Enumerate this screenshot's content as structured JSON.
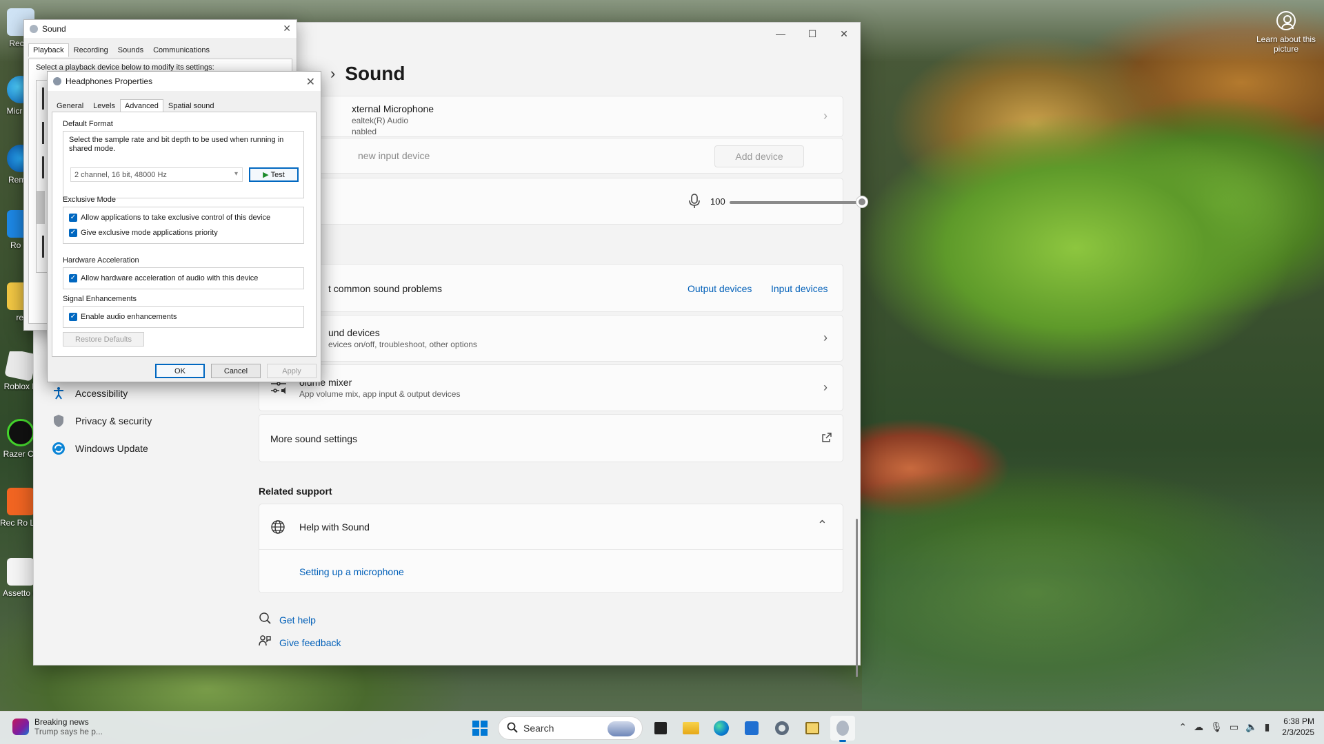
{
  "desktop": {
    "learn_picture": "Learn about this picture",
    "icons": [
      "Recyc",
      "Micr Ed",
      "Rem A",
      "Ro St",
      "rel",
      "Roblox P",
      "Razer Co",
      "Rec Ro Launc",
      "Assetto C"
    ]
  },
  "settings": {
    "breadcrumb_title": "Sound",
    "window_controls": [
      "—",
      "☐",
      "✕"
    ],
    "input_device": {
      "name": "xternal Microphone",
      "vendor": "ealtek(R) Audio",
      "status": "nabled"
    },
    "pair_new": "new input device",
    "add_device": "Add device",
    "volume_value": "100",
    "volume_level": 1.0,
    "troubleshoot": "t common sound problems",
    "output_devices_link": "Output devices",
    "input_devices_link": "Input devices",
    "all_devices_title": "und devices",
    "all_devices_sub": "evices on/off, troubleshoot, other options",
    "mixer_title": "olume mixer",
    "mixer_sub": "App volume mix, app input & output devices",
    "more_settings": "More sound settings",
    "related_support": "Related support",
    "help_with_sound": "Help with Sound",
    "setting_up_mic": "Setting up a microphone",
    "get_help": "Get help",
    "give_feedback": "Give feedback",
    "nav": [
      {
        "label": "Accessibility"
      },
      {
        "label": "Privacy & security"
      },
      {
        "label": "Windows Update"
      }
    ]
  },
  "sound_dialog": {
    "title": "Sound",
    "tabs": [
      "Playback",
      "Recording",
      "Sounds",
      "Communications"
    ],
    "hint": "Select a playback device below to modify its settings:"
  },
  "props_dialog": {
    "title": "Headphones Properties",
    "tabs": [
      "General",
      "Levels",
      "Advanced",
      "Spatial sound"
    ],
    "default_format_title": "Default Format",
    "default_format_desc": "Select the sample rate and bit depth to be used when running in shared mode.",
    "format_value": "2 channel, 16 bit, 48000 Hz",
    "test_label": "Test",
    "exclusive_title": "Exclusive Mode",
    "exclusive_opt1": "Allow applications to take exclusive control of this device",
    "exclusive_opt2": "Give exclusive mode applications priority",
    "hw_title": "Hardware Acceleration",
    "hw_opt1": "Allow hardware acceleration of audio with this device",
    "signal_title": "Signal Enhancements",
    "signal_opt1": "Enable audio enhancements",
    "restore_defaults": "Restore Defaults",
    "ok": "OK",
    "cancel": "Cancel",
    "apply": "Apply"
  },
  "taskbar": {
    "news_title": "Breaking news",
    "news_sub": "Trump says he p...",
    "search_placeholder": "Search",
    "time": "6:38 PM",
    "date": "2/3/2025"
  },
  "colors": {
    "accent": "#0067c0",
    "link": "#005fb8"
  }
}
